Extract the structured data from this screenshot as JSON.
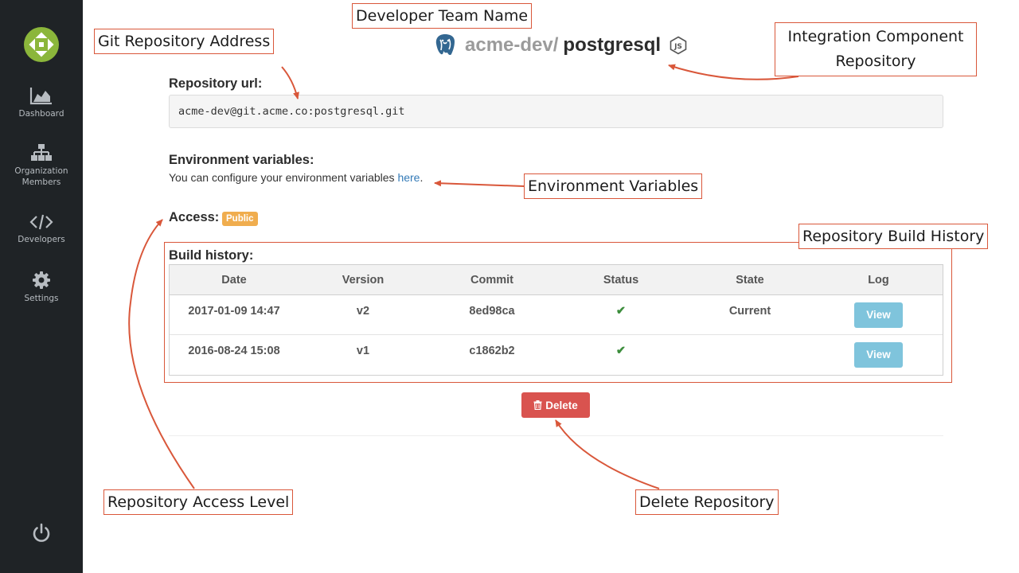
{
  "header": {
    "team": "acme-dev/",
    "repo_name": "postgresql"
  },
  "sidebar": {
    "items": [
      {
        "label": "Dashboard",
        "icon": "area-chart-icon"
      },
      {
        "label": "Organization Members",
        "icon": "org-members-icon"
      },
      {
        "label": "Developers",
        "icon": "code-icon"
      },
      {
        "label": "Settings",
        "icon": "gear-icon"
      }
    ],
    "footer_icon": "power-icon"
  },
  "repository": {
    "url_label": "Repository url:",
    "url": "acme-dev@git.acme.co:postgresql.git",
    "env_label": "Environment variables:",
    "env_text": "You can configure your environment variables ",
    "env_link": "here",
    "env_suffix": ".",
    "access_label": "Access:",
    "access_value": "Public"
  },
  "build_history": {
    "label": "Build history:",
    "columns": [
      "Date",
      "Version",
      "Commit",
      "Status",
      "State",
      "Log"
    ],
    "rows": [
      {
        "date": "2017-01-09 14:47",
        "version": "v2",
        "commit": "8ed98ca",
        "status": "✔",
        "state": "Current",
        "log": "View"
      },
      {
        "date": "2016-08-24 15:08",
        "version": "v1",
        "commit": "c1862b2",
        "status": "✔",
        "state": "",
        "log": "View"
      }
    ]
  },
  "delete_label": "Delete",
  "annotations": {
    "team_name": "Developer Team Name",
    "git_address": "Git Repository Address",
    "integration_line1": "Integration Component",
    "integration_line2": "Repository",
    "env_vars": "Environment Variables",
    "build_history": "Repository Build History",
    "access_level": "Repository Access Level",
    "delete_repo": "Delete Repository"
  },
  "colors": {
    "sidebar_bg": "#1f2326",
    "annotation_border": "#d9573a",
    "badge": "#f0ad4e",
    "view_button": "#7fc4dc",
    "delete_button": "#d9534f",
    "status_ok": "#3c8d3c"
  }
}
